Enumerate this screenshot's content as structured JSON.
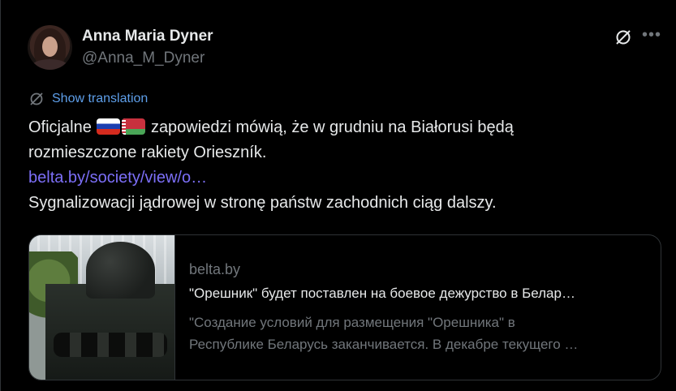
{
  "author": {
    "name": "Anna Maria Dyner",
    "handle": "@Anna_M_Dyner"
  },
  "icons": {
    "header_right": [
      "grok-icon",
      "more-icon"
    ],
    "translate": "translate-icon"
  },
  "translation": {
    "label": "Show translation"
  },
  "post": {
    "line1_before_flags": "Oficjalne",
    "flags": [
      "russia-flag",
      "belarus-flag"
    ],
    "line1_after_flags": "zapowiedzi mówią, że w grudniu na Białorusi będą",
    "line2": "rozmieszczone rakiety Orieszník.",
    "link": "belta.by/society/view/o…",
    "line3": "Sygnalizowacji jądrowej w stronę państw zachodnich ciąg dalszy."
  },
  "card": {
    "domain": "belta.by",
    "title": "\"Орешник\" будет поставлен на боевое дежурство в Белар…",
    "description_line1": "\"Создание условий для размещения \"Орешника\" в",
    "description_line2": "Республике Беларусь заканчивается. В декабре текущего …"
  },
  "colors": {
    "background": "#000000",
    "text": "#e7e9ea",
    "muted": "#71767b",
    "link": "#7c6ff7",
    "translate": "#5e9fea",
    "border": "#2f3336"
  }
}
